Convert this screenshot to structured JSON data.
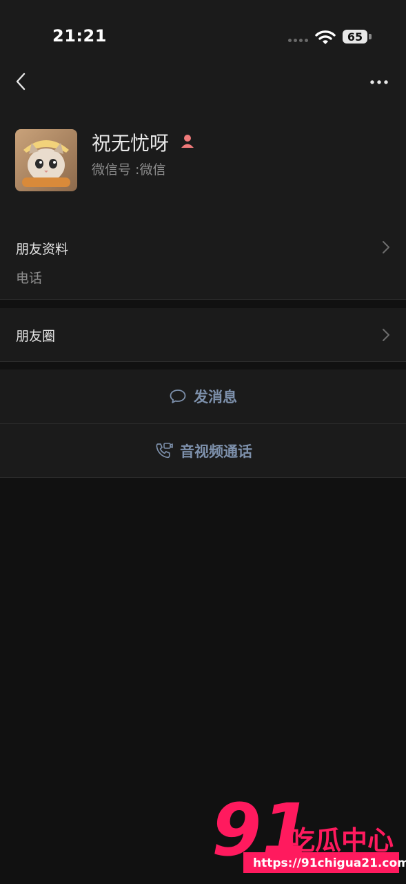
{
  "status_bar": {
    "time": "21:21",
    "battery": "65"
  },
  "profile": {
    "name": "祝无忧呀",
    "wechat_id": "微信号 :微信"
  },
  "friend_info": {
    "label": "朋友资料",
    "phone_label": "电话"
  },
  "moments": {
    "label": "朋友圈"
  },
  "actions": {
    "message": "发消息",
    "call": "音视频通话"
  },
  "watermark": {
    "number": "91",
    "brand": "吃瓜中心",
    "url": "https://91chigua21.com"
  },
  "colors": {
    "background": "#111111",
    "panel": "#1b1b1b",
    "action_text": "#7d90ab",
    "watermark_pink": "#ff1a5e"
  }
}
